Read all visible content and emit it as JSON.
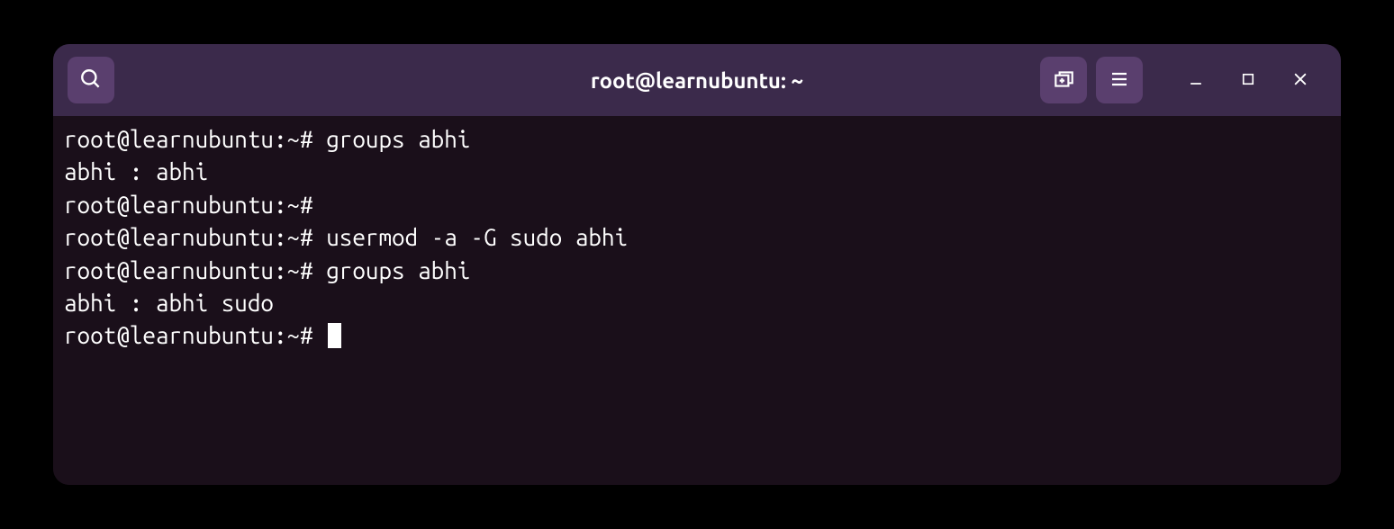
{
  "window": {
    "title": "root@learnubuntu: ~"
  },
  "terminal": {
    "lines": [
      "root@learnubuntu:~# groups abhi",
      "abhi : abhi",
      "root@learnubuntu:~# ",
      "root@learnubuntu:~# usermod -a -G sudo abhi",
      "root@learnubuntu:~# groups abhi",
      "abhi : abhi sudo",
      "root@learnubuntu:~# "
    ]
  }
}
